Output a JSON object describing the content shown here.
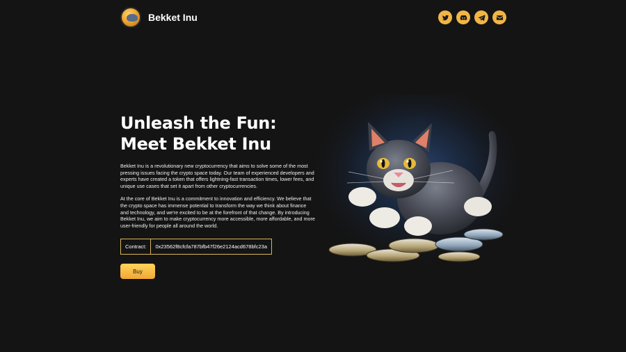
{
  "brand": {
    "name": "Bekket Inu",
    "logo_icon": "cat-coin-logo-icon"
  },
  "socials": [
    {
      "name": "twitter",
      "icon": "twitter-icon"
    },
    {
      "name": "discord",
      "icon": "discord-icon"
    },
    {
      "name": "telegram",
      "icon": "telegram-icon"
    },
    {
      "name": "email",
      "icon": "email-icon"
    }
  ],
  "hero": {
    "title": "Unleash the Fun: Meet Bekket Inu",
    "paragraph1": "Bekket Inu is a revolutionary new cryptocurrency that aims to solve some of the most pressing issues facing the crypto space today. Our team of experienced developers and experts have created a token that offers lightning-fast transaction times, lower fees, and unique use cases that set it apart from other cryptocurrencies.",
    "paragraph2": "At the core of Bekket Inu is a commitment to innovation and efficiency. We believe that the crypto space has immense potential to transform the way we think about finance and technology, and we're excited to be at the forefront of that change. By introducing Bekket Inu, we aim to make cryptocurrency more accessible, more affordable, and more user-friendly for people all around the world.",
    "contract_label": "Contract:",
    "contract_value": "0x23562f8cfcfa787bfb47f26e2124acd678bfc23a",
    "buy_label": "Buy"
  },
  "colors": {
    "background": "#141414",
    "accent": "#f2b544",
    "contract_border": "#d9b85a",
    "glow": "#2b4a7a"
  }
}
